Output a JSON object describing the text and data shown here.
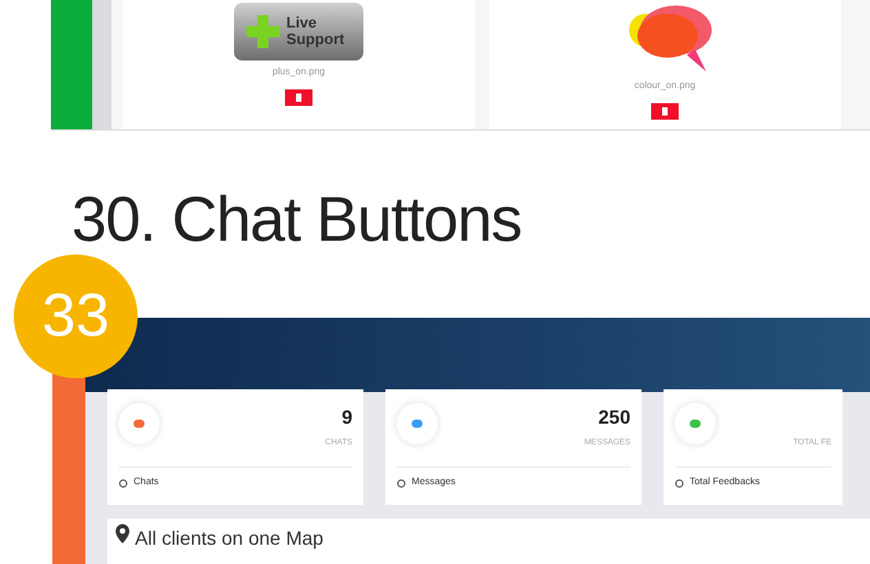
{
  "top_screenshot": {
    "cards": [
      {
        "kind": "support",
        "label": "Live Support",
        "filename": "plus_on.png"
      },
      {
        "kind": "bubble",
        "filename": "colour_on.png"
      }
    ]
  },
  "heading": "30. Chat Buttons",
  "badge": "33",
  "dashboard": {
    "stats": [
      {
        "value": "9",
        "caption": "CHATS",
        "footer": "Chats",
        "color": "#f26b3a"
      },
      {
        "value": "250",
        "caption": "MESSAGES",
        "footer": "Messages",
        "color": "#3b9cf0"
      },
      {
        "caption": "TOTAL FE",
        "footer": "Total Feedbacks",
        "color": "#3cc24a"
      }
    ],
    "map_title": "All clients on one Map"
  }
}
